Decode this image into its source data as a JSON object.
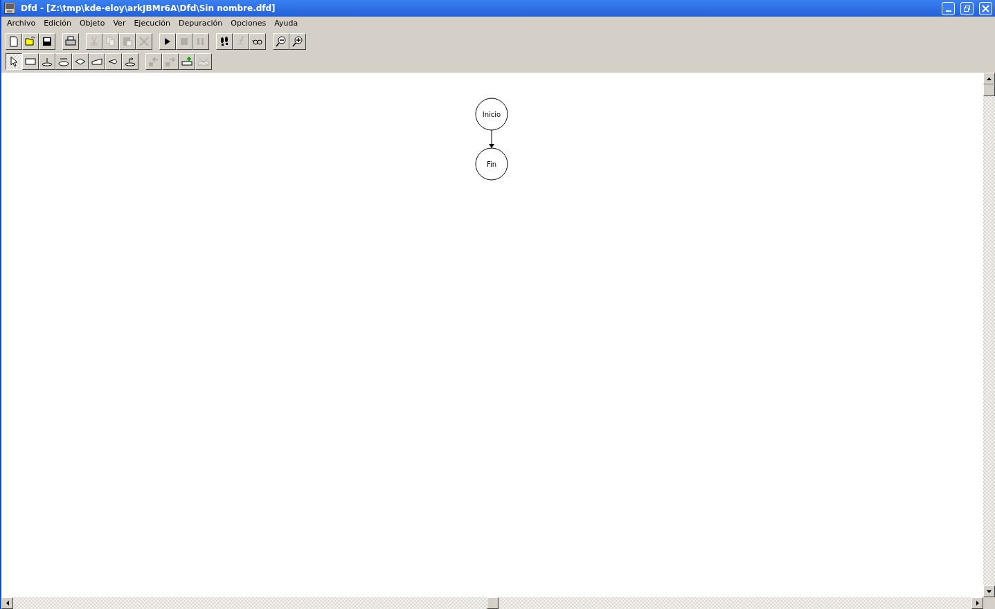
{
  "window": {
    "title": "Dfd - [Z:\\tmp\\kde-eloy\\arkJBMr6A\\Dfd\\Sin nombre.dfd]"
  },
  "menu": [
    {
      "label": "Archivo"
    },
    {
      "label": "Edición"
    },
    {
      "label": "Objeto"
    },
    {
      "label": "Ver"
    },
    {
      "label": "Ejecución"
    },
    {
      "label": "Depuración"
    },
    {
      "label": "Opciones"
    },
    {
      "label": "Ayuda"
    }
  ],
  "toolbars": [
    {
      "groups": [
        [
          {
            "kind": "new",
            "disabled": false
          },
          {
            "kind": "open",
            "disabled": false
          },
          {
            "kind": "save",
            "disabled": false
          }
        ],
        [
          {
            "kind": "print",
            "disabled": false
          }
        ],
        [
          {
            "kind": "cut",
            "disabled": true
          },
          {
            "kind": "copy",
            "disabled": true
          },
          {
            "kind": "paste",
            "disabled": true
          },
          {
            "kind": "delete",
            "disabled": true
          }
        ],
        [
          {
            "kind": "run",
            "disabled": false
          },
          {
            "kind": "stop",
            "disabled": true
          },
          {
            "kind": "pause",
            "disabled": true
          }
        ],
        [
          {
            "kind": "step",
            "disabled": false
          },
          {
            "kind": "walk",
            "disabled": true
          },
          {
            "kind": "watch",
            "disabled": false
          }
        ],
        [
          {
            "kind": "zoom-out",
            "disabled": false
          },
          {
            "kind": "zoom-in",
            "disabled": false
          }
        ]
      ]
    },
    {
      "groups": [
        [
          {
            "kind": "pointer",
            "disabled": false,
            "selected": true
          },
          {
            "kind": "assign",
            "disabled": false,
            "selected": false
          },
          {
            "kind": "read",
            "disabled": false,
            "selected": false
          },
          {
            "kind": "loop",
            "disabled": false,
            "selected": false
          },
          {
            "kind": "decision",
            "disabled": false,
            "selected": false
          },
          {
            "kind": "output",
            "disabled": false,
            "selected": false
          },
          {
            "kind": "while",
            "disabled": false,
            "selected": false
          },
          {
            "kind": "call",
            "disabled": false,
            "selected": false
          }
        ],
        [
          {
            "kind": "prev",
            "disabled": true,
            "selected": false
          },
          {
            "kind": "next",
            "disabled": true,
            "selected": false
          },
          {
            "kind": "add",
            "disabled": false,
            "selected": false
          },
          {
            "kind": "remove",
            "disabled": true,
            "selected": false
          }
        ]
      ]
    }
  ],
  "diagram": {
    "nodes": [
      {
        "kind": "terminal",
        "label": "Inicio"
      },
      {
        "kind": "terminal",
        "label": "Fin"
      }
    ]
  }
}
